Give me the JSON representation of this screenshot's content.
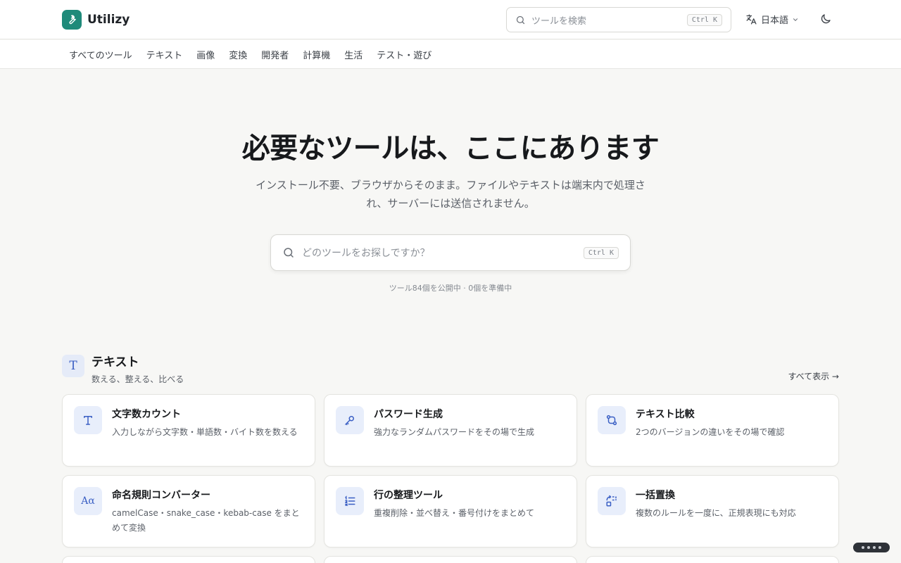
{
  "brand": {
    "name": "Utilizy",
    "logo_icon": "wrench-icon",
    "accent": "#1f8a7a"
  },
  "header": {
    "search_placeholder": "ツールを検索",
    "search_shortcut": "Ctrl K",
    "language": "日本語",
    "theme_icon": "moon-icon"
  },
  "categories": [
    "すべてのツール",
    "テキスト",
    "画像",
    "変換",
    "開発者",
    "計算機",
    "生活",
    "テスト・遊び"
  ],
  "hero": {
    "title": "必要なツールは、ここにあります",
    "subtitle": "インストール不要、ブラウザからそのまま。ファイルやテキストは端末内で処理され、サーバーには送信されません。",
    "search_placeholder": "どのツールをお探しですか？",
    "search_shortcut": "Ctrl K",
    "stats": "ツール84個を公開中 · 0個を準備中"
  },
  "section": {
    "icon": "T",
    "title": "テキスト",
    "subtitle": "数える、整える、比べる",
    "see_all": "すべて表示 →"
  },
  "tools": [
    {
      "icon": "text-t-icon",
      "title": "文字数カウント",
      "desc": "入力しながら文字数・単語数・バイト数を数える"
    },
    {
      "icon": "key-icon",
      "title": "パスワード生成",
      "desc": "強力なランダムパスワードをその場で生成"
    },
    {
      "icon": "git-compare-icon",
      "title": "テキスト比較",
      "desc": "2つのバージョンの違いをその場で確認"
    },
    {
      "icon": "case-icon",
      "title": "命名規則コンバーター",
      "desc": "camelCase・snake_case・kebab-case をまとめて変換"
    },
    {
      "icon": "list-ordered-icon",
      "title": "行の整理ツール",
      "desc": "重複削除・並べ替え・番号付けをまとめて"
    },
    {
      "icon": "replace-icon",
      "title": "一括置換",
      "desc": "複数のルールを一度に、正規表現にも対応"
    }
  ]
}
